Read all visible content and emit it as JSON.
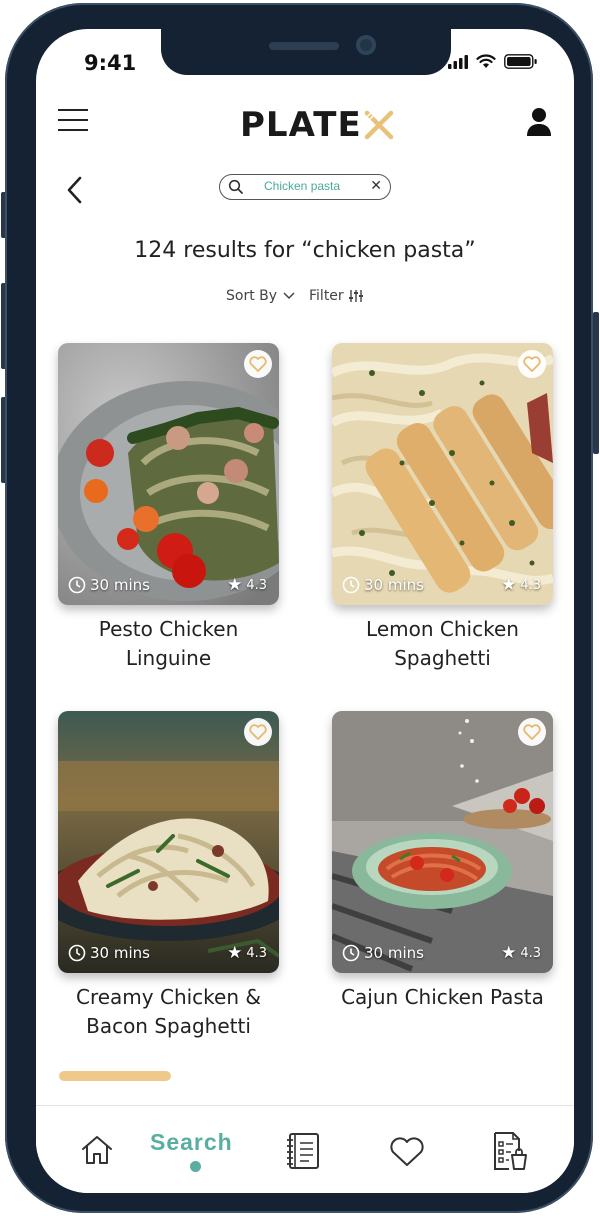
{
  "status_bar": {
    "time": "9:41"
  },
  "header": {
    "logo_text": "PLATE",
    "logo_accent_color": "#e9c27a"
  },
  "search": {
    "query": "Chicken pasta"
  },
  "results": {
    "heading": "124 results for “chicken pasta”",
    "sort_label": "Sort By",
    "filter_label": "Filter"
  },
  "recipes": [
    {
      "title_line1": "Pesto Chicken",
      "title_line2": "Linguine",
      "time": "30 mins",
      "rating": "4.3"
    },
    {
      "title_line1": "Lemon Chicken",
      "title_line2": "Spaghetti",
      "time": "30 mins",
      "rating": "4.3"
    },
    {
      "title_line1": "Creamy Chicken &",
      "title_line2": "Bacon Spaghetti",
      "time": "30 mins",
      "rating": "4.3"
    },
    {
      "title_line1": "Cajun Chicken Pasta",
      "title_line2": "",
      "time": "30 mins",
      "rating": "4.3"
    }
  ],
  "tabbar": {
    "active_label": "Search",
    "active_color": "#5aaea1",
    "icons": [
      "home-icon",
      "search-tab",
      "recipe-book-icon",
      "heart-icon",
      "shopping-list-icon"
    ]
  }
}
